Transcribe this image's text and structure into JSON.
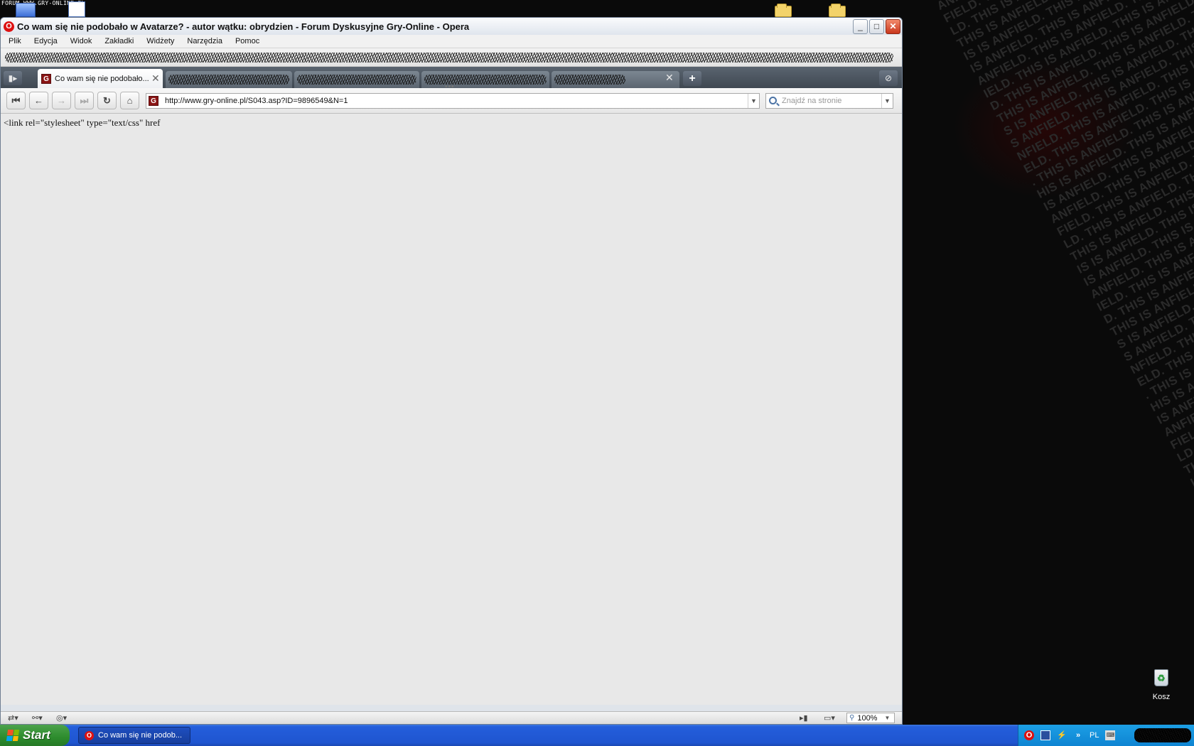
{
  "desktop": {
    "top_watermark": "FORUM WWW.GRY-ONLINE.PL",
    "wallpaper_phrase": "THIS IS ANFIELD.",
    "recycle_bin_label": "Kosz"
  },
  "window": {
    "title": "Co wam się nie podobało w Avatarze? - autor wątku: obrydzien - Forum Dyskusyjne Gry-Online - Opera",
    "buttons": {
      "minimize": "_",
      "maximize": "□",
      "close": "✕"
    }
  },
  "menu": {
    "items": [
      "Plik",
      "Edycja",
      "Widok",
      "Zakładki",
      "Widżety",
      "Narzędzia",
      "Pomoc"
    ]
  },
  "tabs": {
    "active_label": "Co wam się nie podobało...",
    "close_glyph": "✕",
    "new_tab_glyph": "+"
  },
  "navigation": {
    "address": "http://www.gry-online.pl/S043.asp?ID=9896549&N=1",
    "search_placeholder": "Znajdź na stronie",
    "dropdown_glyph": "▼"
  },
  "content": {
    "text": "<link rel=\"stylesheet\" type=\"text/css\" href"
  },
  "status_bar": {
    "zoom": "100%"
  },
  "taskbar": {
    "start_label": "Start",
    "task_opera_label": "Co wam się nie podob...",
    "language": "PL"
  },
  "colors": {
    "titlebar": "#dfe5ed",
    "tabbar": "#4a5360",
    "content_background": "#e8e8e8",
    "taskbar": "#245edb",
    "start_button": "#2d8c2d",
    "tray": "#0e84d2"
  }
}
